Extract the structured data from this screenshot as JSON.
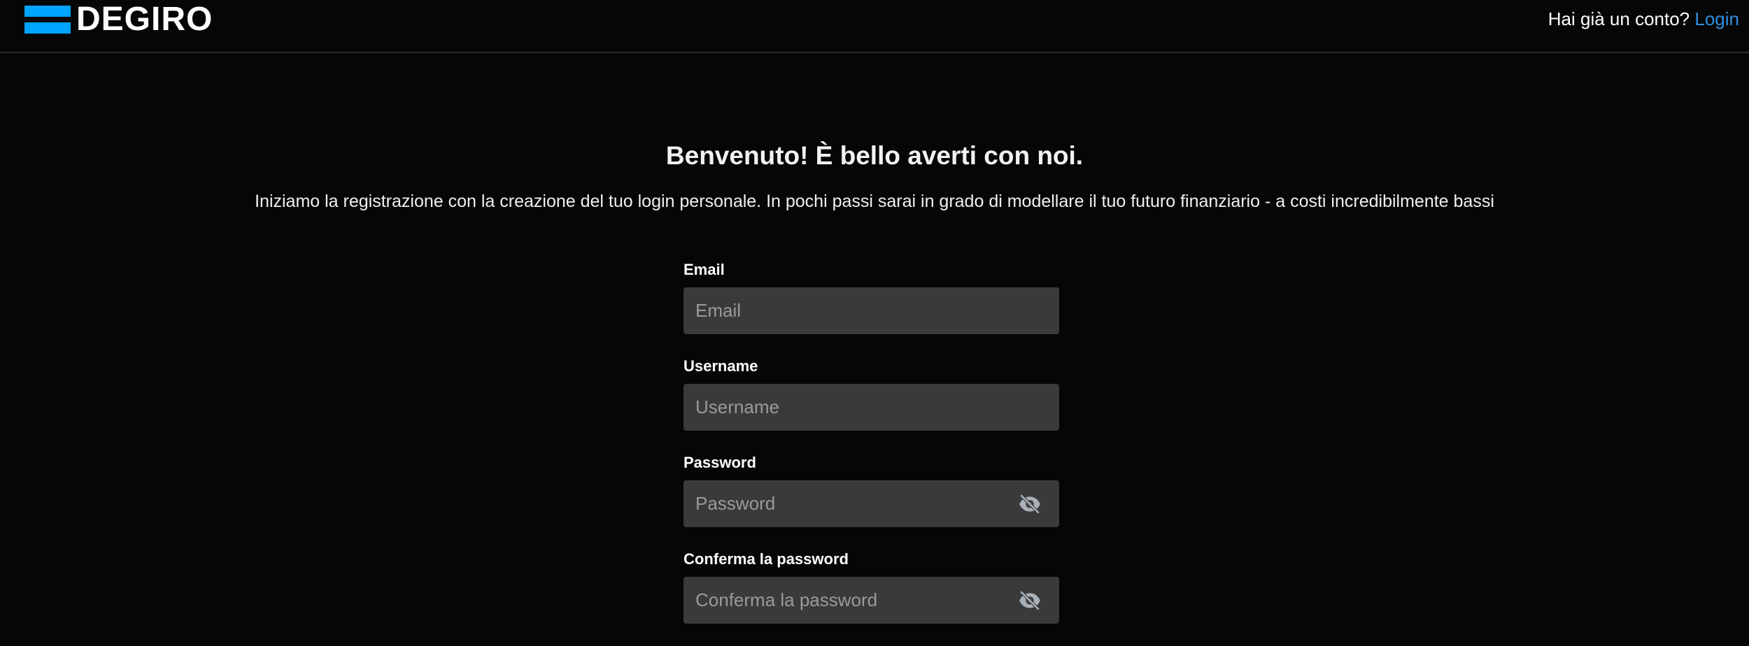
{
  "colors": {
    "brand": "#00a4ff",
    "link": "#2f8fe0",
    "background": "#060606",
    "input_bg": "#3a3a3a"
  },
  "header": {
    "logo_text": "DEGIRO",
    "account_prompt": "Hai già un conto?",
    "login_link": "Login"
  },
  "main": {
    "title": "Benvenuto! È bello averti con noi.",
    "subtitle": "Iniziamo la registrazione con la creazione del tuo login personale. In pochi passi sarai in grado di modellare il tuo futuro finanziario - a costi incredibilmente bassi"
  },
  "form": {
    "email": {
      "label": "Email",
      "placeholder": "Email",
      "value": ""
    },
    "username": {
      "label": "Username",
      "placeholder": "Username",
      "value": ""
    },
    "password": {
      "label": "Password",
      "placeholder": "Password",
      "value": "",
      "icon": "eye-off-icon"
    },
    "confirm_password": {
      "label": "Conferma la password",
      "placeholder": "Conferma la password",
      "value": "",
      "icon": "eye-off-icon"
    }
  }
}
